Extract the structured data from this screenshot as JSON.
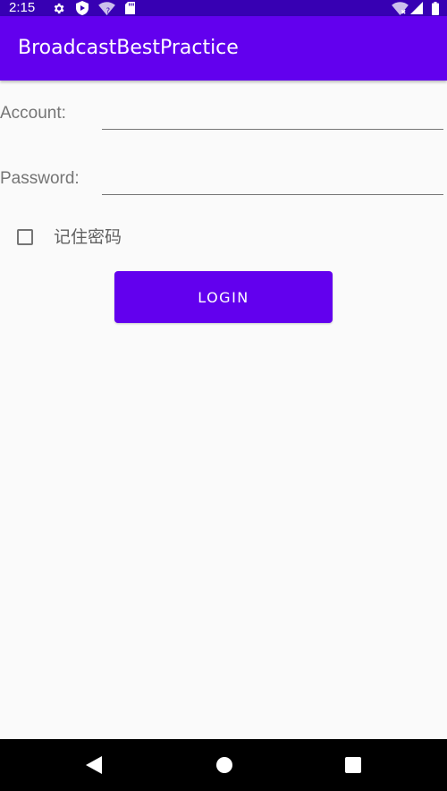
{
  "status_bar": {
    "time": "2:15",
    "icons": [
      "gear-icon",
      "play-protect-icon",
      "wifi-question-icon",
      "sd-card-icon",
      "wifi-x-icon",
      "cellular-signal-icon",
      "battery-icon"
    ],
    "background": "#3700b3"
  },
  "app_bar": {
    "title": "BroadcastBestPractice",
    "background": "#6200ee"
  },
  "form": {
    "account_label": "Account:",
    "account_value": "",
    "password_label": "Password:",
    "password_value": "",
    "remember_label": "记住密码",
    "remember_checked": false,
    "login_label": "LOGIN"
  },
  "nav_bar": {
    "icons": [
      "back-icon",
      "home-icon",
      "recents-icon"
    ]
  },
  "colors": {
    "accent": "#6200ee",
    "status": "#3700b3",
    "label": "#757575"
  }
}
